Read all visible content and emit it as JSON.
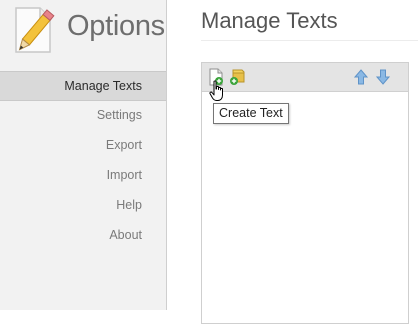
{
  "app": {
    "title": "Options"
  },
  "sidebar": {
    "items": [
      {
        "label": "Manage Texts",
        "active": true
      },
      {
        "label": "Settings",
        "active": false
      },
      {
        "label": "Export",
        "active": false
      },
      {
        "label": "Import",
        "active": false
      },
      {
        "label": "Help",
        "active": false
      },
      {
        "label": "About",
        "active": false
      }
    ]
  },
  "main": {
    "title": "Manage Texts"
  },
  "toolbar": {
    "buttons": [
      {
        "icon": "new-document-plus-icon"
      },
      {
        "icon": "new-folder-plus-icon"
      },
      {
        "icon": "arrow-up-icon"
      },
      {
        "icon": "arrow-down-icon"
      }
    ]
  },
  "tooltip": {
    "text": "Create Text"
  },
  "colors": {
    "sidebar_bg": "#f2f2f2",
    "active_item_bg": "#d9d9d9",
    "toolbar_bg": "#e4e4e4",
    "arrow_blue": "#6aa3d8",
    "plus_green": "#3aa33a"
  }
}
